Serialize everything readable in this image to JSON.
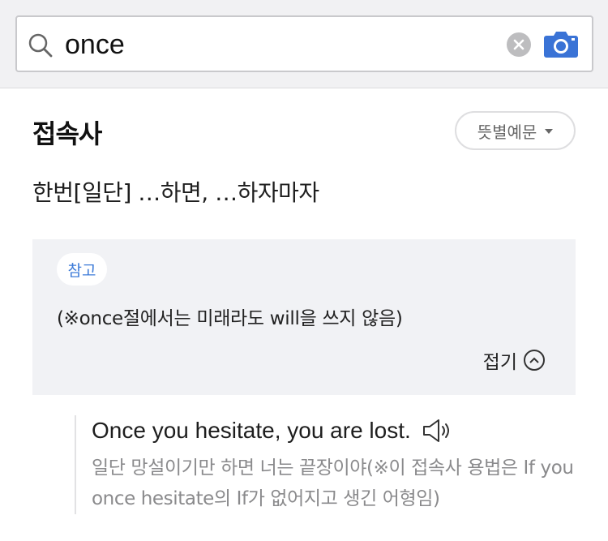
{
  "search": {
    "value": "once",
    "icons": {
      "search": "search-icon",
      "clear": "clear-icon",
      "camera": "camera-icon"
    },
    "camera_color": "#3a73d6"
  },
  "entry": {
    "part_of_speech": "접속사",
    "highlight_color": "#f4f000",
    "filter_button_label": "뜻별예문",
    "meaning": "한번[일단] …하면, …하자마자"
  },
  "note": {
    "badge": "참고",
    "text": "(※once절에서는 미래라도 will을 쓰지 않음)",
    "collapse_label": "접기"
  },
  "example": {
    "english": "Once you hesitate, you are lost.",
    "korean": "일단 망설이기만 하면 너는 끝장이야(※이 접속사 용법은 If you once hesitate의 If가 없어지고 생긴 어형임)"
  }
}
